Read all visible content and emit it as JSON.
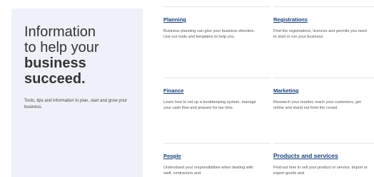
{
  "hero": {
    "heading_line1": "Information",
    "heading_line2": "to help your",
    "heading_line3": "business",
    "heading_line4": "succeed.",
    "intro": "Tools, tips and information to plan, start and grow your business."
  },
  "cards": [
    {
      "title": "Planning",
      "text": "Business planning can give your business direction. Use our tools and templates to help you."
    },
    {
      "title": "Registrations",
      "text": "Find the registrations, licences and permits you need to start or run your business."
    },
    {
      "title": "Finance",
      "text": "Learn how to set up a bookkeeping system, manage your cash flow and prepare for tax time."
    },
    {
      "title": "Marketing",
      "text": "Research your market, reach your customers, get online and stand out from the crowd."
    },
    {
      "title": "People",
      "text": "Understand your responsibilities when dealing with staff, contractors and"
    },
    {
      "title": "Products and services",
      "text": "Find out how to sell your product or service, import or export goods and"
    }
  ],
  "colors": {
    "hero_background": "#eef2f8",
    "link": "#1a3f7a",
    "divider": "#e3e3e3"
  }
}
